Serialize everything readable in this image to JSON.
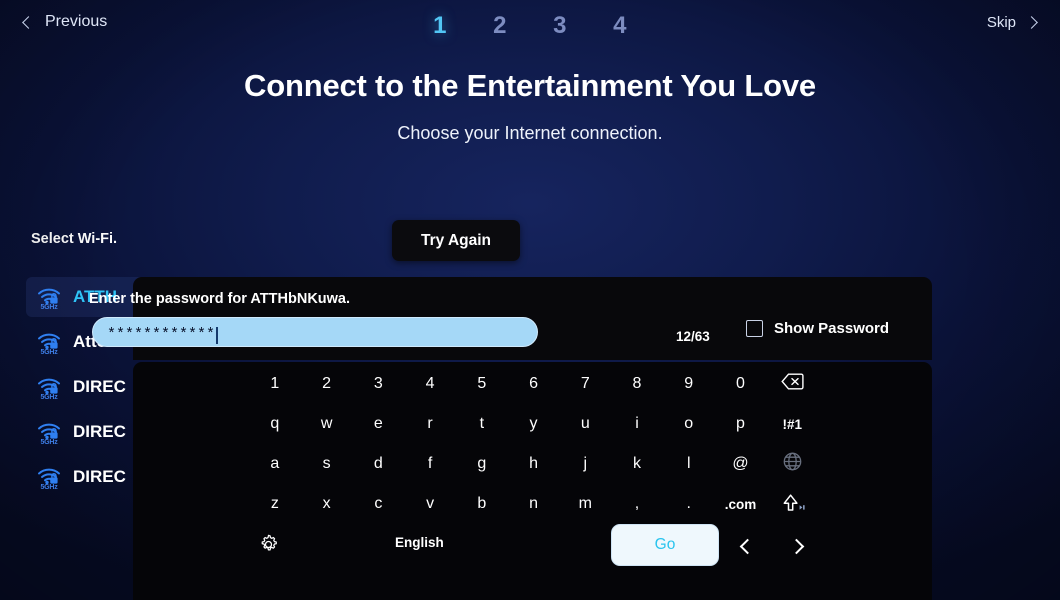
{
  "nav": {
    "previous_label": "Previous",
    "skip_label": "Skip",
    "prev_icon": "chevron-left-icon",
    "skip_icon": "chevron-right-icon"
  },
  "steps": [
    {
      "label": "1",
      "active": true
    },
    {
      "label": "2",
      "active": false
    },
    {
      "label": "3",
      "active": false
    },
    {
      "label": "4",
      "active": false
    }
  ],
  "header": {
    "title": "Connect to the Entertainment You Love",
    "subtitle": "Choose your Internet connection."
  },
  "wifi_section": {
    "label": "Select Wi-Fi.",
    "try_again_label": "Try Again",
    "networks": [
      {
        "name": "ATTH",
        "band": "5GHz",
        "secured": true,
        "selected": true
      },
      {
        "name": "Attorn",
        "band": "5GHz",
        "secured": true,
        "selected": false
      },
      {
        "name": "DIREC",
        "band": "5GHz",
        "secured": true,
        "selected": false
      },
      {
        "name": "DIREC",
        "band": "5GHz",
        "secured": true,
        "selected": false
      },
      {
        "name": "DIREC",
        "band": "5GHz",
        "secured": true,
        "selected": false
      }
    ]
  },
  "password_dialog": {
    "prompt": "Enter the password for ATTHbNKuwa.",
    "input_value": "************",
    "input_placeholder": "",
    "char_count": "12/63",
    "show_password_label": "Show Password",
    "show_password_checked": false
  },
  "keyboard": {
    "rows": [
      [
        {
          "label": "1",
          "name": "key-1"
        },
        {
          "label": "2",
          "name": "key-2"
        },
        {
          "label": "3",
          "name": "key-3"
        },
        {
          "label": "4",
          "name": "key-4"
        },
        {
          "label": "5",
          "name": "key-5"
        },
        {
          "label": "6",
          "name": "key-6"
        },
        {
          "label": "7",
          "name": "key-7"
        },
        {
          "label": "8",
          "name": "key-8"
        },
        {
          "label": "9",
          "name": "key-9"
        },
        {
          "label": "0",
          "name": "key-0"
        },
        {
          "label": "",
          "name": "key-backspace",
          "icon": "backspace-icon"
        }
      ],
      [
        {
          "label": "q",
          "name": "key-q"
        },
        {
          "label": "w",
          "name": "key-w"
        },
        {
          "label": "e",
          "name": "key-e"
        },
        {
          "label": "r",
          "name": "key-r"
        },
        {
          "label": "t",
          "name": "key-t"
        },
        {
          "label": "y",
          "name": "key-y"
        },
        {
          "label": "u",
          "name": "key-u"
        },
        {
          "label": "i",
          "name": "key-i"
        },
        {
          "label": "o",
          "name": "key-o"
        },
        {
          "label": "p",
          "name": "key-p"
        },
        {
          "label": "!#1",
          "name": "key-symbols",
          "small": true
        }
      ],
      [
        {
          "label": "a",
          "name": "key-a"
        },
        {
          "label": "s",
          "name": "key-s"
        },
        {
          "label": "d",
          "name": "key-d"
        },
        {
          "label": "f",
          "name": "key-f"
        },
        {
          "label": "g",
          "name": "key-g"
        },
        {
          "label": "h",
          "name": "key-h"
        },
        {
          "label": "j",
          "name": "key-j"
        },
        {
          "label": "k",
          "name": "key-k"
        },
        {
          "label": "l",
          "name": "key-l"
        },
        {
          "label": "@",
          "name": "key-at"
        },
        {
          "label": "",
          "name": "key-globe",
          "icon": "globe-icon",
          "dim": true
        }
      ],
      [
        {
          "label": "z",
          "name": "key-z"
        },
        {
          "label": "x",
          "name": "key-x"
        },
        {
          "label": "c",
          "name": "key-c"
        },
        {
          "label": "v",
          "name": "key-v"
        },
        {
          "label": "b",
          "name": "key-b"
        },
        {
          "label": "n",
          "name": "key-n"
        },
        {
          "label": "m",
          "name": "key-m"
        },
        {
          "label": ",",
          "name": "key-comma"
        },
        {
          "label": ".",
          "name": "key-period"
        },
        {
          "label": ".com",
          "name": "key-dotcom",
          "small": true
        },
        {
          "label": "",
          "name": "key-shift",
          "icon": "shift-icon"
        }
      ]
    ],
    "bottom": {
      "settings_icon": "gear-icon",
      "language_label": "English",
      "go_label": "Go",
      "prev_icon": "chevron-left-icon",
      "next_icon": "chevron-right-icon"
    }
  },
  "colors": {
    "accent_cyan": "#2fc4f7",
    "panel_black": "#08080b",
    "input_blue": "#a5d8f7",
    "background_navy": "#0b1440"
  }
}
